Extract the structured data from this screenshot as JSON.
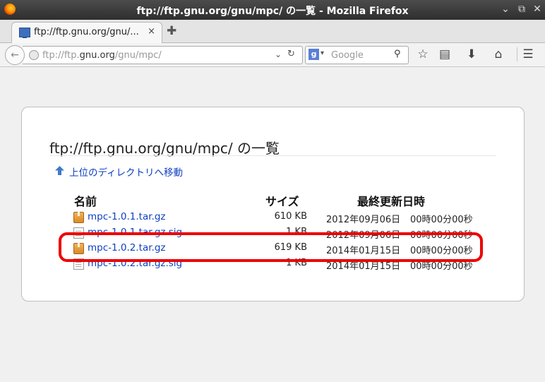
{
  "window": {
    "title": "ftp://ftp.gnu.org/gnu/mpc/ の一覧 - Mozilla Firefox",
    "controls": [
      "chevron-down-icon",
      "restore-icon",
      "close-icon"
    ]
  },
  "tab": {
    "label": "ftp://ftp.gnu.org/gnu/...",
    "close": "×",
    "new_tab": "✚"
  },
  "navbar": {
    "url_scheme": "ftp://ftp.",
    "url_host": "gnu.org",
    "url_path": "/gnu/mpc/",
    "search_placeholder": "Google",
    "search_engine_letter": "g"
  },
  "page": {
    "heading": "ftp://ftp.gnu.org/gnu/mpc/ の一覧",
    "up_link": "上位のディレクトリへ移動",
    "columns": {
      "name": "名前",
      "size": "サイズ",
      "modified": "最終更新日時"
    },
    "files": [
      {
        "name": "mpc-1.0.1.tar.gz",
        "size": "610 KB",
        "date": "2012年09月06日",
        "time": "00時00分00秒",
        "icon": "package-icon"
      },
      {
        "name": "mpc-1.0.1.tar.gz.sig",
        "size": "1 KB",
        "date": "2012年09月06日",
        "time": "00時00分00秒",
        "icon": "document-icon"
      },
      {
        "name": "mpc-1.0.2.tar.gz",
        "size": "619 KB",
        "date": "2014年01月15日",
        "time": "00時00分00秒",
        "icon": "package-icon"
      },
      {
        "name": "mpc-1.0.2.tar.gz.sig",
        "size": "1 KB",
        "date": "2014年01月15日",
        "time": "00時00分00秒",
        "icon": "document-icon"
      }
    ]
  },
  "colors": {
    "link": "#0d3fc0",
    "highlight": "#ee0000",
    "titlebar": "#3a3a3a"
  }
}
